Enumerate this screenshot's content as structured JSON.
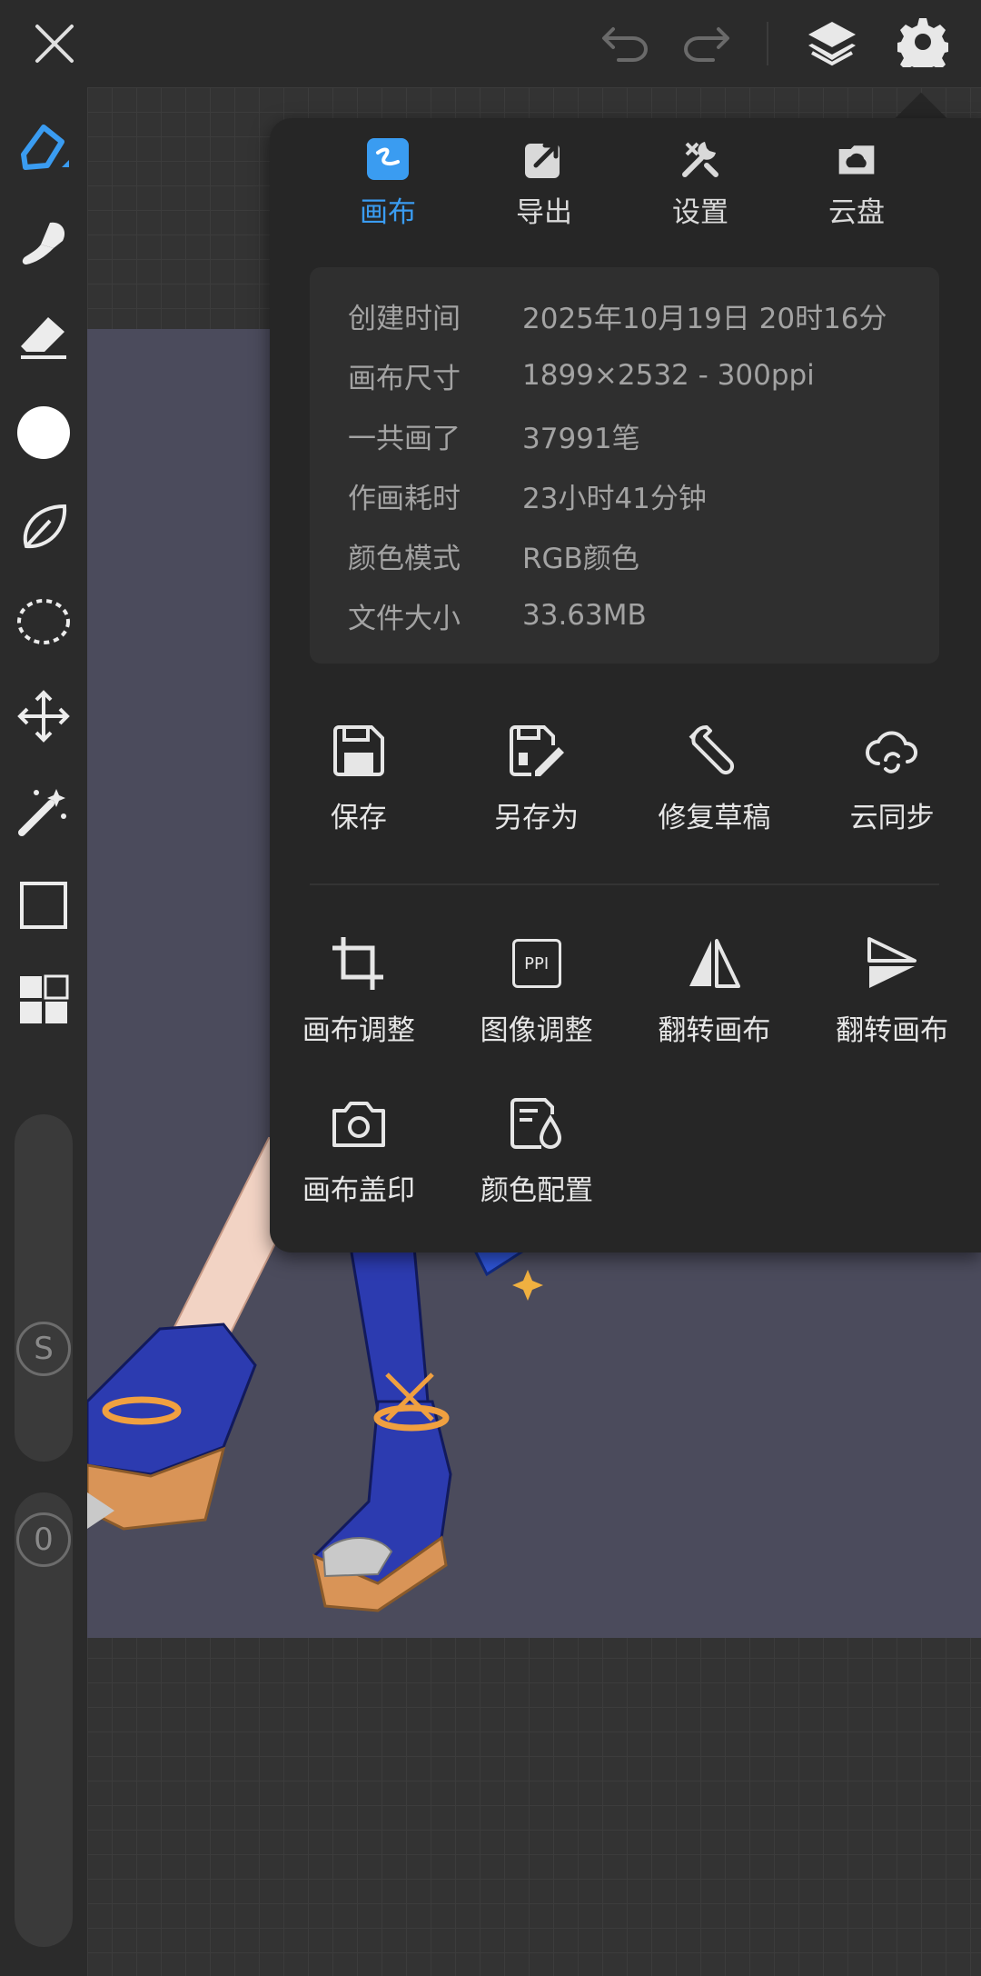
{
  "topbar": {
    "icons": [
      "close-icon",
      "undo-icon",
      "redo-icon",
      "layers-icon",
      "gear-icon"
    ]
  },
  "sidebar": {
    "tools": [
      "pen-icon",
      "smudge-icon",
      "eraser-icon",
      "color-circle",
      "leaf-icon",
      "lasso-icon",
      "move-icon",
      "magic-wand-icon",
      "rectangle-icon",
      "grid-icon"
    ],
    "size_label": "S",
    "opacity_label": "0",
    "accent_color": "#3a9cf1"
  },
  "popup": {
    "tabs": [
      {
        "label": "画布",
        "icon": "canvas-icon",
        "active": true
      },
      {
        "label": "导出",
        "icon": "export-icon",
        "active": false
      },
      {
        "label": "设置",
        "icon": "settings-tools-icon",
        "active": false
      },
      {
        "label": "云盘",
        "icon": "cloud-drive-icon",
        "active": false
      }
    ],
    "info": [
      {
        "key": "创建时间",
        "value": "2025年10月19日 20时16分"
      },
      {
        "key": "画布尺寸",
        "value": "1899×2532 - 300ppi"
      },
      {
        "key": "一共画了",
        "value": "37991笔"
      },
      {
        "key": "作画耗时",
        "value": "23小时41分钟"
      },
      {
        "key": "颜色模式",
        "value": "RGB颜色"
      },
      {
        "key": "文件大小",
        "value": "33.63MB"
      }
    ],
    "actions_row1": [
      {
        "label": "保存",
        "icon": "save-icon"
      },
      {
        "label": "另存为",
        "icon": "save-as-icon"
      },
      {
        "label": "修复草稿",
        "icon": "wrench-icon"
      },
      {
        "label": "云同步",
        "icon": "cloud-sync-icon"
      }
    ],
    "actions_row2": [
      {
        "label": "画布调整",
        "icon": "crop-icon"
      },
      {
        "label": "图像调整",
        "icon": "ppi-icon",
        "icon_text": "PPI"
      },
      {
        "label": "翻转画布",
        "icon": "flip-horizontal-icon"
      },
      {
        "label": "翻转画布",
        "icon": "flip-vertical-icon"
      }
    ],
    "actions_row3": [
      {
        "label": "画布盖印",
        "icon": "camera-icon"
      },
      {
        "label": "颜色配置",
        "icon": "color-profile-icon"
      }
    ]
  }
}
